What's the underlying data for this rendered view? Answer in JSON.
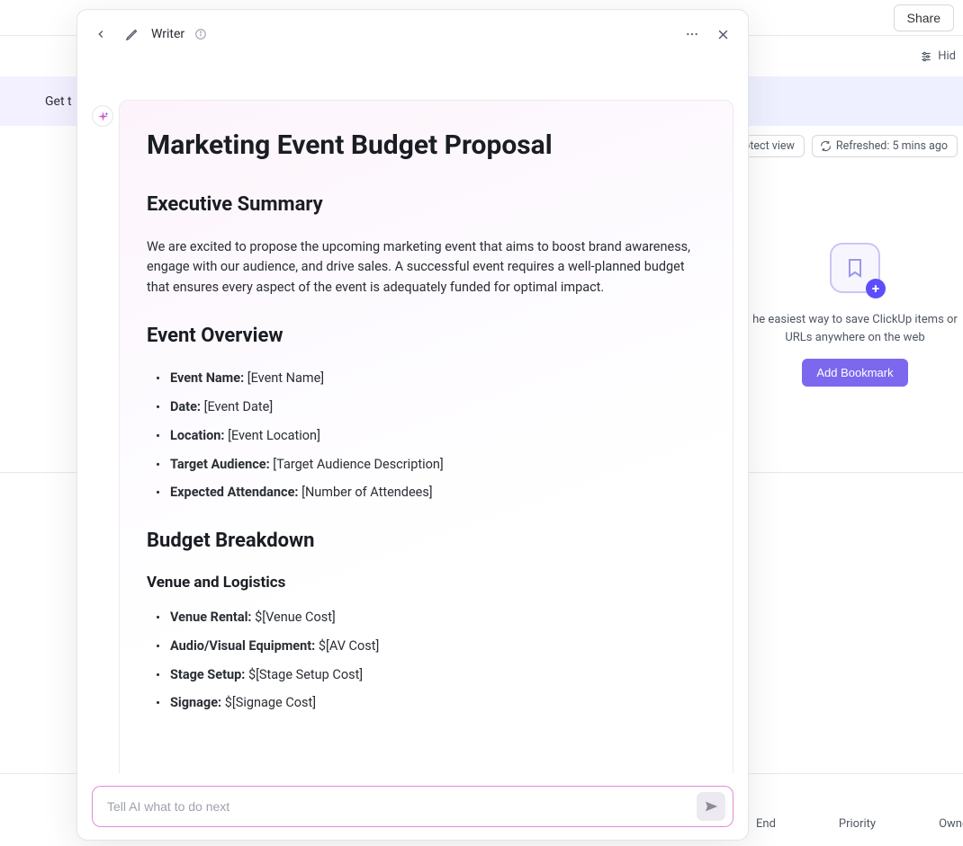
{
  "background": {
    "share_label": "Share",
    "hide_label": "Hid",
    "banner_text": "Get t",
    "protect_view_label": "Protect view",
    "refreshed_label": "Refreshed: 5 mins ago",
    "bookmark_text": "he easiest way to save ClickUp items or URLs anywhere on the web",
    "bookmark_button": "Add Bookmark",
    "footer_cols": {
      "end": "End",
      "priority": "Priority",
      "owner": "Owne"
    }
  },
  "writer": {
    "title": "Writer",
    "prompt_placeholder": "Tell AI what to do next"
  },
  "doc": {
    "title": "Marketing Event Budget Proposal",
    "exec_heading": "Executive Summary",
    "exec_para": "We are excited to propose the upcoming marketing event that aims to boost brand awareness, engage with our audience, and drive sales. A successful event requires a well-planned budget that ensures every aspect of the event is adequately funded for optimal impact.",
    "overview_heading": "Event Overview",
    "overview_items": [
      {
        "label": "Event Name:",
        "value": " [Event Name]"
      },
      {
        "label": "Date:",
        "value": " [Event Date]"
      },
      {
        "label": "Location:",
        "value": " [Event Location]"
      },
      {
        "label": "Target Audience:",
        "value": " [Target Audience Description]"
      },
      {
        "label": "Expected Attendance:",
        "value": " [Number of Attendees]"
      }
    ],
    "budget_heading": "Budget Breakdown",
    "venue_heading": "Venue and Logistics",
    "venue_items": [
      {
        "label": "Venue Rental:",
        "value": " $[Venue Cost]"
      },
      {
        "label": "Audio/Visual Equipment:",
        "value": " $[AV Cost]"
      },
      {
        "label": "Stage Setup:",
        "value": " $[Stage Setup Cost]"
      },
      {
        "label": "Signage:",
        "value": " $[Signage Cost]"
      }
    ]
  }
}
